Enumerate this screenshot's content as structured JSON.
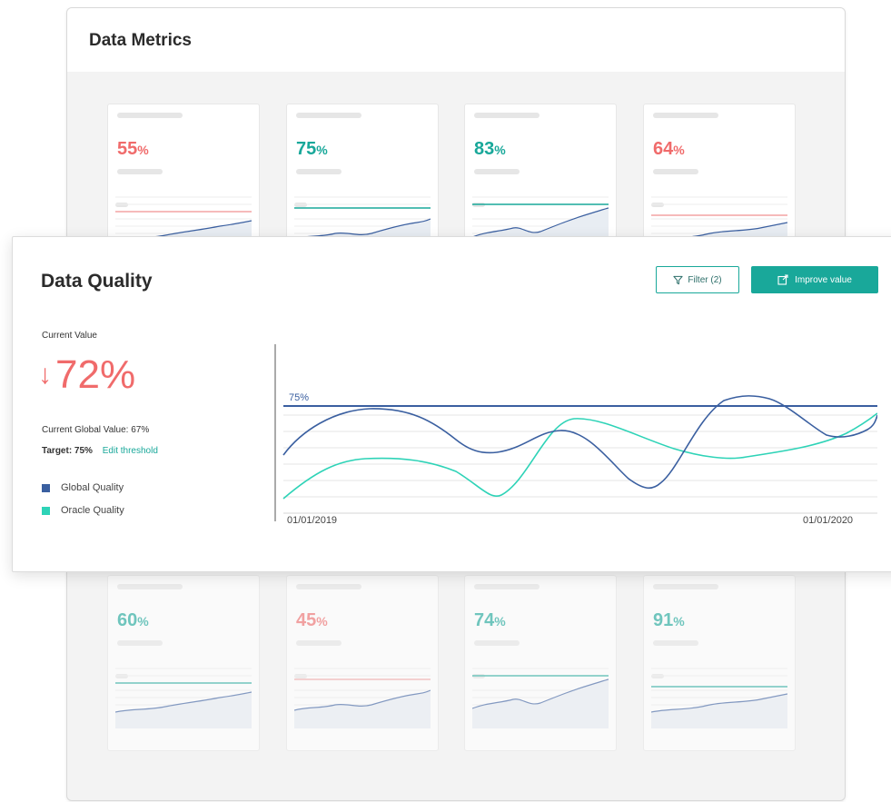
{
  "back_window": {
    "title": "Data Metrics",
    "cards": [
      {
        "value": "55",
        "unit": "%",
        "color": "#f06b6b",
        "faded": false
      },
      {
        "value": "75",
        "unit": "%",
        "color": "#19a89a",
        "faded": false
      },
      {
        "value": "83",
        "unit": "%",
        "color": "#19a89a",
        "faded": false
      },
      {
        "value": "64",
        "unit": "%",
        "color": "#f06b6b",
        "faded": false
      },
      {
        "value": "60",
        "unit": "%",
        "color": "#19a89a",
        "faded": true
      },
      {
        "value": "45",
        "unit": "%",
        "color": "#f06b6b",
        "faded": true
      },
      {
        "value": "74",
        "unit": "%",
        "color": "#19a89a",
        "faded": true
      },
      {
        "value": "91",
        "unit": "%",
        "color": "#19a89a",
        "faded": true
      }
    ]
  },
  "panel": {
    "title": "Data Quality",
    "filter_label": "Filter (2)",
    "filter_icon": "filter-funnel-icon",
    "improve_label": "Improve value",
    "improve_icon": "external-link-icon",
    "current_value_label": "Current Value",
    "current_value_arrow": "↓",
    "current_value": "72%",
    "current_global_value": "Current Global Value: 67%",
    "target_label": "Target: 75%",
    "edit_threshold": "Edit threshold",
    "legend": [
      {
        "name": "Global Quality",
        "color": "#3a5fa0"
      },
      {
        "name": "Oracle Quality",
        "color": "#2ed3b7"
      }
    ],
    "x_start": "01/01/2019",
    "x_end": "01/01/2020",
    "threshold_label": "75%"
  },
  "colors": {
    "accent": "#19a89a",
    "negative": "#f06b6b",
    "global_line": "#3a5fa0",
    "oracle_line": "#2ed3b7"
  }
}
